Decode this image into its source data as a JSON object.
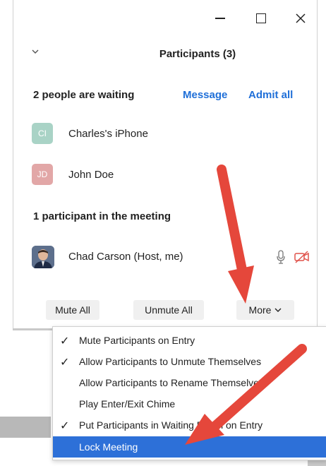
{
  "window": {
    "controls": [
      "minimize",
      "maximize",
      "close"
    ]
  },
  "panel": {
    "title": "Participants (3)"
  },
  "waiting": {
    "title": "2 people are waiting",
    "message_label": "Message",
    "admit_all_label": "Admit all",
    "people": [
      {
        "initials": "CI",
        "name": "Charles's iPhone",
        "color": "#a9d3c6"
      },
      {
        "initials": "JD",
        "name": "John Doe",
        "color": "#e2a7a7"
      }
    ]
  },
  "meeting": {
    "title": "1 participant in the meeting",
    "participants": [
      {
        "name": "Chad Carson (Host, me)",
        "mic": "mic-icon",
        "video": "video-off-icon"
      }
    ]
  },
  "buttons": {
    "mute_all": "Mute All",
    "unmute_all": "Unmute All",
    "more": "More"
  },
  "menu": {
    "items": [
      {
        "label": "Mute Participants on Entry",
        "checked": true
      },
      {
        "label": "Allow Participants to Unmute Themselves",
        "checked": true
      },
      {
        "label": "Allow Participants to Rename Themselves",
        "checked": false
      },
      {
        "label": "Play Enter/Exit Chime",
        "checked": false
      },
      {
        "label": "Put Participants in Waiting Room on Entry",
        "checked": true
      },
      {
        "label": "Lock Meeting",
        "checked": false,
        "highlighted": true
      }
    ],
    "check_glyph": "✓"
  },
  "colors": {
    "link": "#1f6fd8",
    "highlight": "#2d70d8",
    "arrow": "#e5473b",
    "video_off": "#e0524a"
  }
}
